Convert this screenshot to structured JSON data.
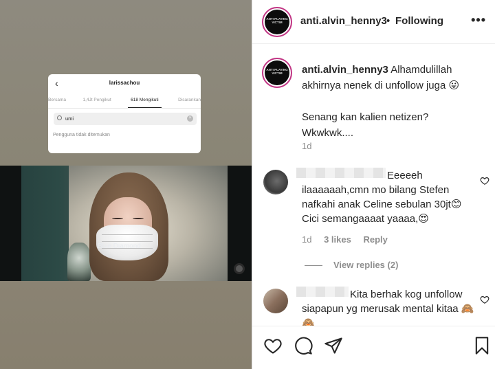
{
  "post": {
    "username": "anti.alvin_henny3",
    "follow_status": "Following",
    "more_label": "•••",
    "avatar_text": "ANTI PLAYING VICTIM",
    "caption_text": "Alhamdulillah akhirnya nenek di unfollow juga 😛",
    "caption_text2": "Senang kan kalien netizen?",
    "caption_text3": "Wkwkwk....",
    "caption_time": "1d"
  },
  "screenshot": {
    "back_icon": "chevron-left-icon",
    "username": "larissachou",
    "tabs": [
      "Bersama",
      "1,4Jt Pengikut",
      "618 Mengikuti",
      "Disarankan"
    ],
    "search_value": "umi",
    "empty_text": "Pengguna tidak ditemukan"
  },
  "video": {
    "watermark": "Blue Diamond"
  },
  "comments": [
    {
      "text": "Eeeeeh ilaaaaaah,cmn mo bilang Stefen nafkahi anak Celine sebulan 30jt😊 Cici semangaaaat yaaaa,😍",
      "time": "1d",
      "likes": "3 likes",
      "reply": "Reply",
      "view_replies": "View replies (2)"
    },
    {
      "text": "Kita berhak kog unfollow siapapun yg merusak mental kitaa 🙈🙈"
    }
  ],
  "colors": {
    "text": "#262626",
    "muted": "#8e8e8e",
    "ring": "#c13584"
  }
}
